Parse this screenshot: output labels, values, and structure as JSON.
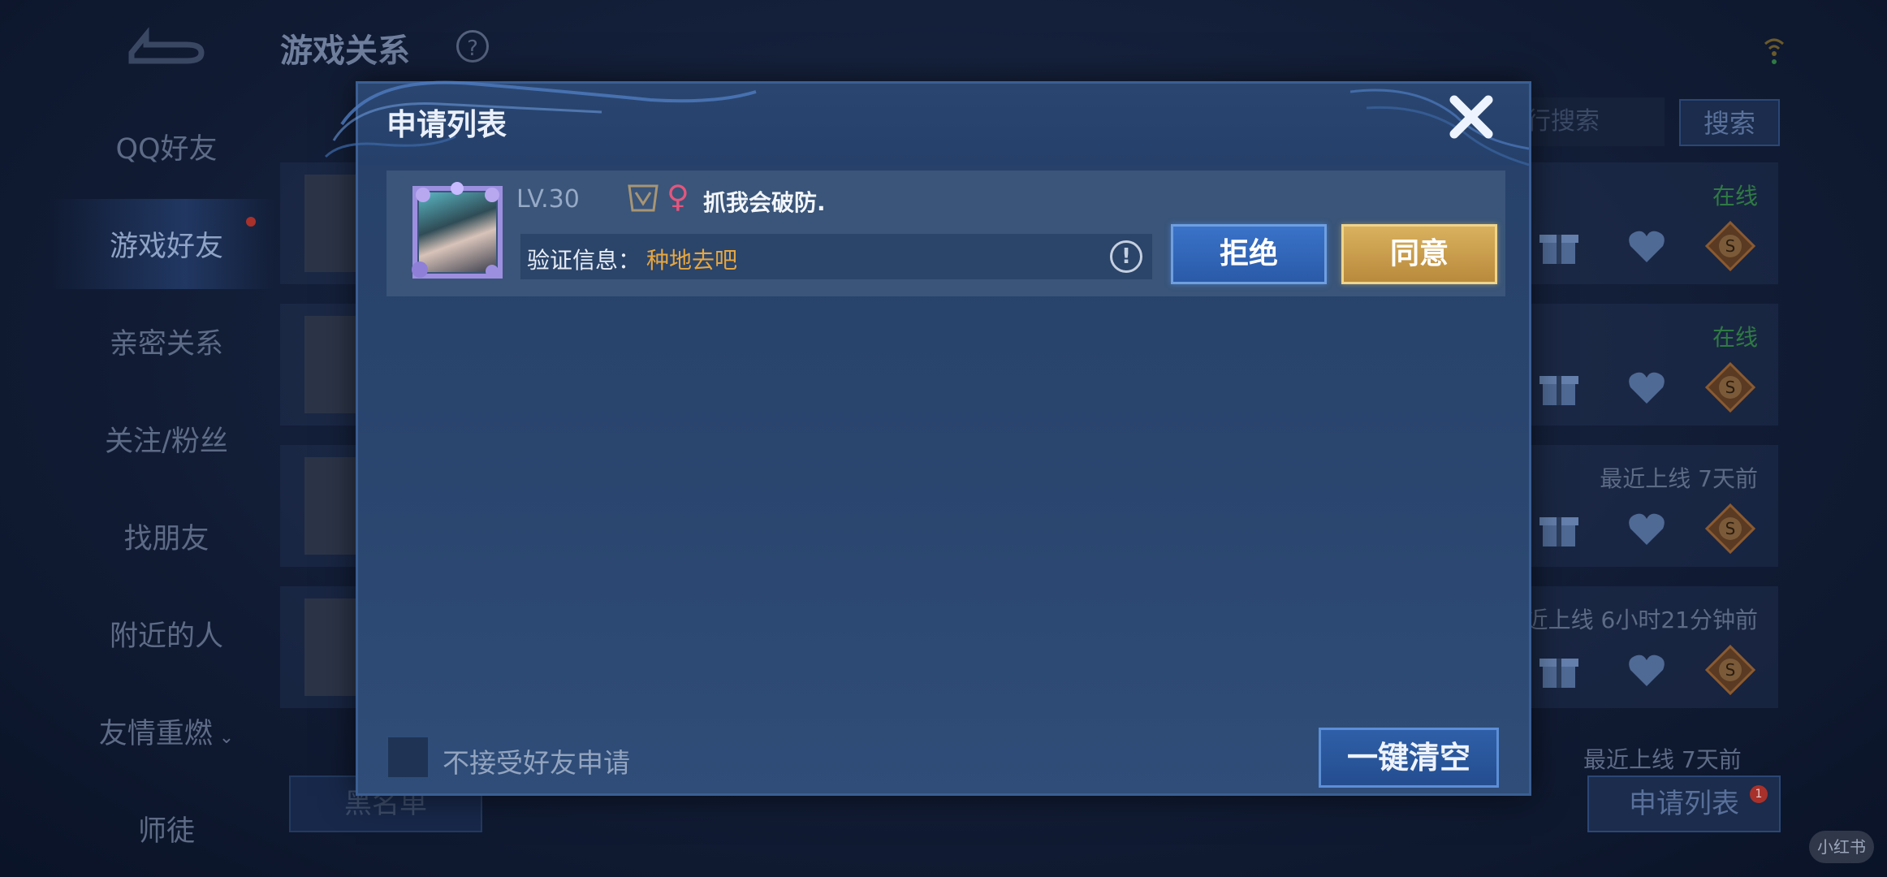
{
  "background": {
    "page_title": "游戏关系",
    "help_icon": "question-icon",
    "sidebar": [
      {
        "label": "QQ好友",
        "active": false
      },
      {
        "label": "游戏好友",
        "active": true
      },
      {
        "label": "亲密关系",
        "active": false
      },
      {
        "label": "关注/粉丝",
        "active": false
      },
      {
        "label": "找朋友",
        "active": false
      },
      {
        "label": "附近的人",
        "active": false
      },
      {
        "label": "友情重燃",
        "active": false
      },
      {
        "label": "师徒",
        "active": false
      }
    ],
    "search_placeholder": "行搜索",
    "search_button": "搜索",
    "friends": [
      {
        "status": "在线",
        "online": true
      },
      {
        "status": "在线",
        "online": true
      },
      {
        "status": "最近上线  7天前",
        "online": false
      },
      {
        "status": "近上线  6小时21分钟前",
        "online": false
      }
    ],
    "last_row_status": "最近上线  7天前",
    "blacklist_button": "黑名单",
    "apply_list_button": "申请列表",
    "apply_badge": "1",
    "watermark": "小红书"
  },
  "modal": {
    "title": "申请列表",
    "close_icon": "close-icon",
    "requests": [
      {
        "level": "LV.30",
        "gender_symbol": "♀",
        "name": "抓我会破防.",
        "verify_label": "验证信息：",
        "verify_text": "种地去吧",
        "reject_label": "拒绝",
        "accept_label": "同意"
      }
    ],
    "reject_all_checkbox_label": "不接受好友申请",
    "reject_all_checked": false,
    "clear_all_label": "一键清空"
  },
  "colors": {
    "accent_gold": "#e6a640",
    "online_green": "#2f7a44",
    "female_pink": "#e3567d"
  }
}
